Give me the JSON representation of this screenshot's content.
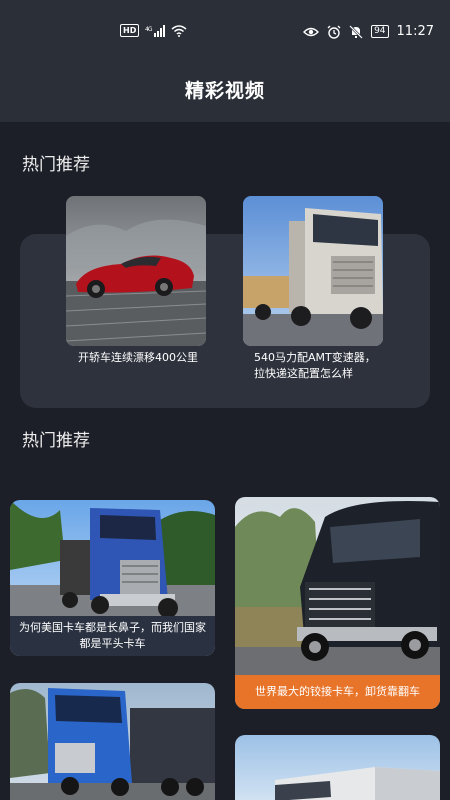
{
  "status_bar": {
    "left_icons": [
      "hd-icon",
      "signal-icon",
      "wifi-icon"
    ],
    "hd_label": "HD",
    "net_label": "⁴ᴳ",
    "battery": "94",
    "time": "11:27"
  },
  "header": {
    "title": "精彩视频"
  },
  "sections": [
    {
      "title": "热门推荐"
    },
    {
      "title": "热门推荐"
    }
  ],
  "recommend": [
    {
      "caption": "开轿车连续漂移400公里",
      "image": "red-sports-car"
    },
    {
      "caption": "540马力配AMT变速器，拉快递这配置怎么样",
      "image": "silver-truck"
    }
  ],
  "grid": [
    {
      "caption": "为何美国卡车都是长鼻子，而我们国家都是平头卡车",
      "image": "blue-longnose-truck"
    },
    {
      "caption": "世界最大的铰接卡车，卸货靠翻车",
      "image": "black-mack-truck"
    },
    {
      "caption": "",
      "image": "blue-daf-truck"
    },
    {
      "caption": "",
      "image": "white-semi-truck"
    }
  ],
  "colors": {
    "background": "#1c1f27",
    "header": "#2b2f38",
    "panel": "#2e323c",
    "accent": "#e8742a"
  }
}
